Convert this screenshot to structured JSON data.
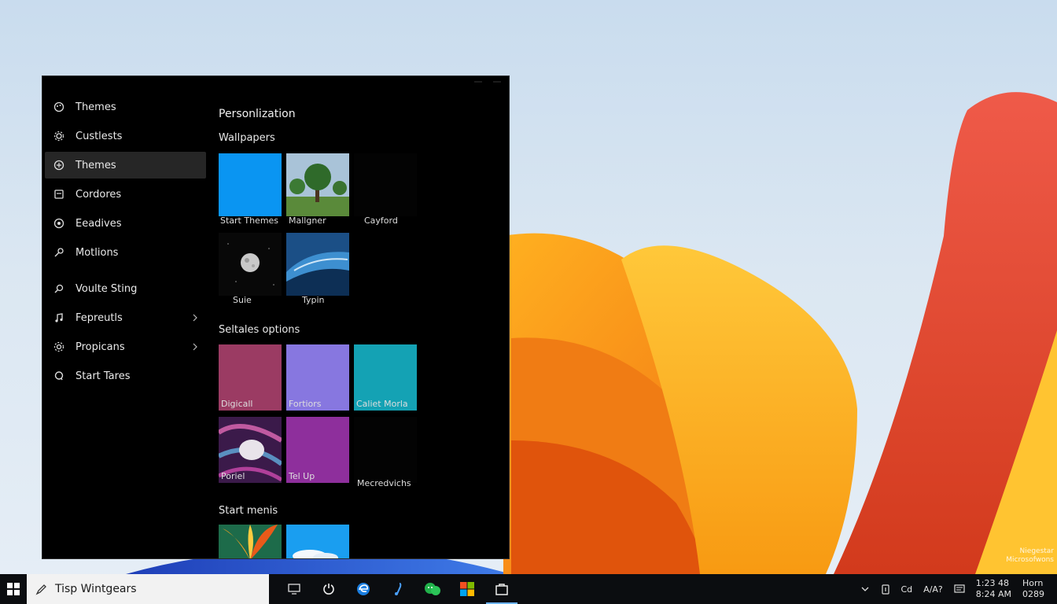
{
  "settings": {
    "nav": [
      {
        "label": "Themes",
        "icon": "palette-icon"
      },
      {
        "label": "Custlests",
        "icon": "gear-icon"
      },
      {
        "label": "Themes",
        "icon": "theme-icon",
        "active": true
      },
      {
        "label": "Cordores",
        "icon": "screen-icon"
      },
      {
        "label": "Eeadives",
        "icon": "circle-icon"
      },
      {
        "label": "Motlions",
        "icon": "pen-icon"
      },
      {
        "label": "Voulte Sting",
        "icon": "search-icon"
      },
      {
        "label": "Fepreutls",
        "icon": "music-icon",
        "chevron": true
      },
      {
        "label": "Propicans",
        "icon": "gear-icon",
        "chevron": true
      },
      {
        "label": "Start Tares",
        "icon": "loop-icon"
      }
    ],
    "page_title": "Personlization",
    "sections": {
      "wallpapers": "Wallpapers",
      "options": "Seltales options",
      "start_menus": "Start menis"
    },
    "wallpapers": [
      {
        "caption": "Start Themes"
      },
      {
        "caption": "Mallgner"
      },
      {
        "caption": "Cayford"
      },
      {
        "caption": "Suie"
      },
      {
        "caption": "Typin"
      }
    ],
    "options": [
      {
        "caption": "Digicall",
        "color": "#9b3b63"
      },
      {
        "caption": "Fortiors",
        "color": "#8777e0"
      },
      {
        "caption": "Caliet Morla",
        "color": "#14a2b4"
      },
      {
        "caption": "Poriel"
      },
      {
        "caption": "Tel Up",
        "color": "#8e2f9c"
      },
      {
        "caption": "Mecredvichs"
      }
    ]
  },
  "taskbar": {
    "search_text": "Tisp Wintgears",
    "tray": {
      "lang": "Cd",
      "input": "A/A?",
      "time": "1:23 48",
      "date": "8:24 AM",
      "extra_top": "Horn",
      "extra_bottom": "0289"
    }
  },
  "desktop": {
    "watermark": "Niegestar Microsofwons"
  },
  "colors": {
    "accent": "#6cb4ff",
    "window_bg": "#000000",
    "active_nav": "#262626"
  }
}
